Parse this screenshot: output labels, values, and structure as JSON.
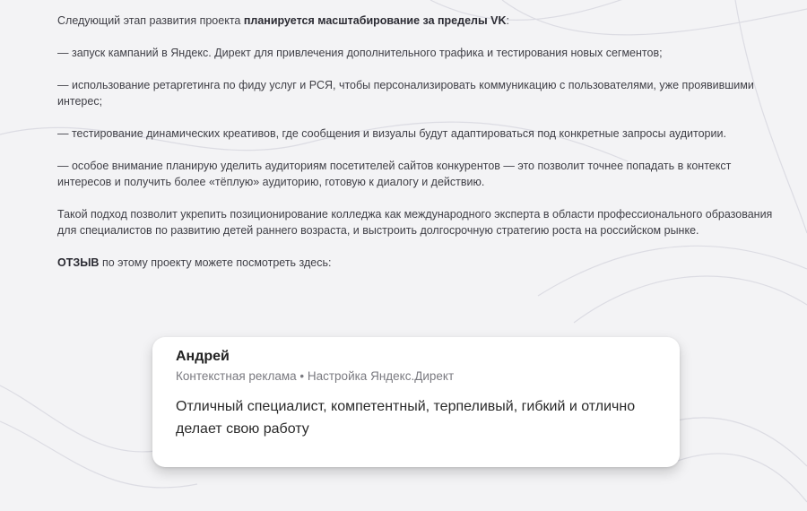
{
  "article": {
    "intro_prefix": "Следующий этап развития проекта ",
    "intro_bold": "планируется масштабирование за пределы VK",
    "intro_suffix": ":",
    "bullets": [
      "— запуск кампаний в Яндекс. Директ для привлечения дополнительного трафика и тестирования новых сегментов;",
      "— использование ретаргетинга по фиду услуг и РСЯ, чтобы персонализировать коммуникацию с пользователями, уже проявившими интерес;",
      "— тестирование динамических креативов, где сообщения и визуалы будут адаптироваться под конкретные запросы аудитории.",
      "— особое внимание планирую уделить аудиториям посетителей сайтов конкурентов — это позволит точнее попадать в контекст интересов и получить более «тёплую» аудиторию, готовую к диалогу и действию."
    ],
    "conclusion": "Такой подход позволит укрепить позиционирование колледжа как международного эксперта в области профессионального образования для специалистов по развитию детей раннего возраста, и выстроить долгосрочную стратегию роста на российском рынке.",
    "review_prompt_bold": "ОТЗЫВ",
    "review_prompt_rest": " по этому проекту можете посмотреть здесь:"
  },
  "review": {
    "author": "Андрей",
    "meta": "Контекстная реклама • Настройка Яндекс.Директ",
    "text": "Отличный специалист, компетентный, терпеливый, гибкий и отлично делает свою работу"
  },
  "colors": {
    "background": "#f3f3f5",
    "text": "#3f3f46",
    "card": "#ffffff"
  }
}
